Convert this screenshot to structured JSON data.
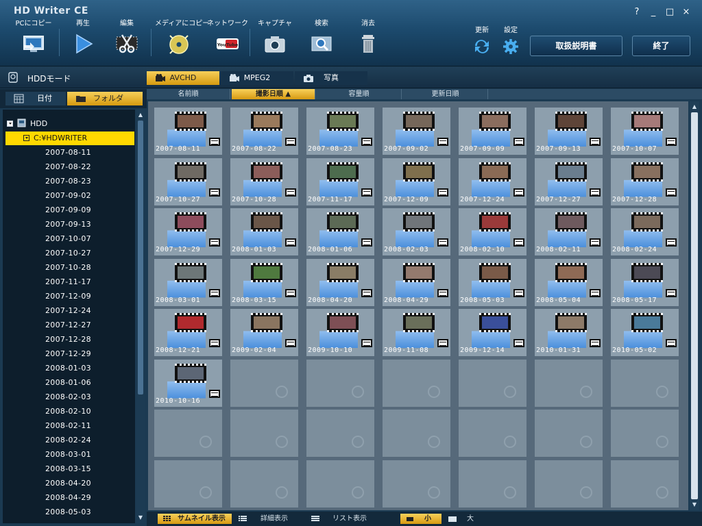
{
  "window": {
    "title": "HD Writer CE",
    "controls": {
      "help": "?",
      "minimize": "_",
      "maximize": "□",
      "close": "×"
    }
  },
  "toolbar": {
    "items": [
      {
        "label": "PCにコピー",
        "icon": "pc-copy-icon"
      },
      {
        "label": "再生",
        "icon": "play-icon"
      },
      {
        "label": "編集",
        "icon": "scissors-icon"
      },
      {
        "label": "メディアにコピー",
        "icon": "disc-icon"
      },
      {
        "label": "ネットワーク",
        "icon": "youtube-icon"
      },
      {
        "label": "キャプチャ",
        "icon": "camera-icon"
      },
      {
        "label": "検索",
        "icon": "search-icon"
      },
      {
        "label": "消去",
        "icon": "trash-icon"
      },
      {
        "label": "更新",
        "icon": "refresh-icon"
      },
      {
        "label": "設定",
        "icon": "gear-icon"
      }
    ],
    "youtube_text": "YouTube",
    "manual_button": "取扱説明書",
    "exit_button": "終了"
  },
  "modebar": {
    "mode_label": "HDDモード",
    "tabs": [
      {
        "label": "AVCHD",
        "active": true
      },
      {
        "label": "MPEG2",
        "active": false
      },
      {
        "label": "写真",
        "active": false
      }
    ]
  },
  "left_tabs": {
    "date": "日付",
    "folder": "フォルダ"
  },
  "tree": {
    "root": "HDD",
    "folder": "C:¥HDWRITER",
    "dates": [
      "2007-08-11",
      "2007-08-22",
      "2007-08-23",
      "2007-09-02",
      "2007-09-09",
      "2007-09-13",
      "2007-10-07",
      "2007-10-27",
      "2007-10-28",
      "2007-11-17",
      "2007-12-09",
      "2007-12-24",
      "2007-12-27",
      "2007-12-28",
      "2007-12-29",
      "2008-01-03",
      "2008-01-06",
      "2008-02-03",
      "2008-02-10",
      "2008-02-11",
      "2008-02-24",
      "2008-03-01",
      "2008-03-15",
      "2008-04-20",
      "2008-04-29",
      "2008-05-03"
    ]
  },
  "sort": {
    "columns": [
      {
        "label": "名前順",
        "active": false
      },
      {
        "label": "撮影日順 ▲",
        "active": true
      },
      {
        "label": "容量順",
        "active": false
      },
      {
        "label": "更新日順",
        "active": false
      }
    ]
  },
  "grid": {
    "columns": 7,
    "total_cells": 56,
    "items": [
      {
        "date": "2007-08-11",
        "color": "#7d5a49"
      },
      {
        "date": "2007-08-22",
        "color": "#9a7a5c"
      },
      {
        "date": "2007-08-23",
        "color": "#6a7a55"
      },
      {
        "date": "2007-09-02",
        "color": "#76675a"
      },
      {
        "date": "2007-09-09",
        "color": "#8b6d5e"
      },
      {
        "date": "2007-09-13",
        "color": "#5e4438"
      },
      {
        "date": "2007-10-07",
        "color": "#a67a79"
      },
      {
        "date": "2007-10-27",
        "color": "#6f6a63"
      },
      {
        "date": "2007-10-28",
        "color": "#8c5d5a"
      },
      {
        "date": "2007-11-17",
        "color": "#4d6c4e"
      },
      {
        "date": "2007-12-09",
        "color": "#7f6f4d"
      },
      {
        "date": "2007-12-24",
        "color": "#8a6a55"
      },
      {
        "date": "2007-12-27",
        "color": "#6a7d8e"
      },
      {
        "date": "2007-12-28",
        "color": "#88705f"
      },
      {
        "date": "2007-12-29",
        "color": "#8d4c5c"
      },
      {
        "date": "2008-01-03",
        "color": "#6a5648"
      },
      {
        "date": "2008-01-06",
        "color": "#5c6a55"
      },
      {
        "date": "2008-02-03",
        "color": "#70757a"
      },
      {
        "date": "2008-02-10",
        "color": "#9a3a3a"
      },
      {
        "date": "2008-02-11",
        "color": "#6e5a5e"
      },
      {
        "date": "2008-02-24",
        "color": "#7b6a5c"
      },
      {
        "date": "2008-03-01",
        "color": "#6d7778"
      },
      {
        "date": "2008-03-15",
        "color": "#4f7a3f"
      },
      {
        "date": "2008-04-20",
        "color": "#8a7d66"
      },
      {
        "date": "2008-04-29",
        "color": "#947a6e"
      },
      {
        "date": "2008-05-03",
        "color": "#7a5a48"
      },
      {
        "date": "2008-05-04",
        "color": "#8f6a55"
      },
      {
        "date": "2008-05-17",
        "color": "#4c4a55"
      },
      {
        "date": "2008-12-21",
        "color": "#b02a2e"
      },
      {
        "date": "2009-02-04",
        "color": "#8a7560"
      },
      {
        "date": "2009-10-10",
        "color": "#7e4f55"
      },
      {
        "date": "2009-11-08",
        "color": "#6a6f5a"
      },
      {
        "date": "2009-12-14",
        "color": "#3a4f9a"
      },
      {
        "date": "2010-01-31",
        "color": "#8d7a68"
      },
      {
        "date": "2010-05-02",
        "color": "#4a7a9a"
      },
      {
        "date": "2010-10-16",
        "color": "#5c6675"
      }
    ]
  },
  "bottombar": {
    "thumbnail_view": "サムネイル表示",
    "detail_view": "詳細表示",
    "list_view": "リスト表示",
    "size_small": "小",
    "size_large": "大"
  }
}
